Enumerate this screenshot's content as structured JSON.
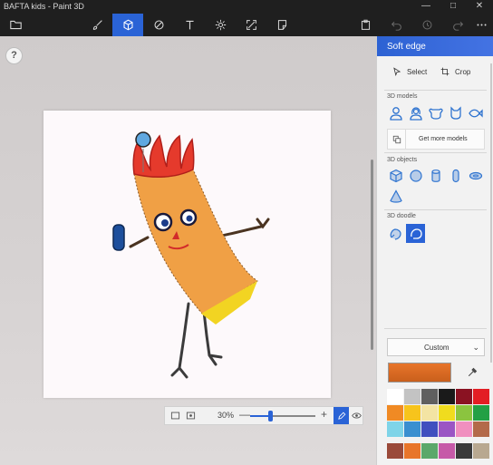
{
  "window": {
    "title": "BAFTA kids - Paint 3D",
    "controls": [
      "minimize",
      "maximize",
      "close"
    ]
  },
  "toolbar": {
    "items": [
      {
        "name": "menu",
        "icon": "folder-icon"
      },
      {
        "name": "brushes",
        "icon": "brush-icon"
      },
      {
        "name": "3d-shapes",
        "icon": "cube-icon",
        "active": true
      },
      {
        "name": "2d-shapes",
        "icon": "shapes-icon"
      },
      {
        "name": "text",
        "icon": "text-icon"
      },
      {
        "name": "effects",
        "icon": "effects-icon"
      },
      {
        "name": "canvas",
        "icon": "canvas-icon"
      },
      {
        "name": "stickers",
        "icon": "sticker-icon"
      },
      {
        "name": "paste",
        "icon": "paste-icon"
      },
      {
        "name": "undo",
        "icon": "undo-icon"
      },
      {
        "name": "history",
        "icon": "history-icon"
      },
      {
        "name": "redo",
        "icon": "redo-icon"
      },
      {
        "name": "more",
        "icon": "more-icon"
      }
    ]
  },
  "workspace": {
    "help": "?"
  },
  "bottombar": {
    "zoom_label": "30%",
    "minus": "—",
    "plus": "+",
    "zoom_fraction": 0.3
  },
  "panel": {
    "header": "Soft edge",
    "select_label": "Select",
    "crop_label": "Crop",
    "models_label": "3D models",
    "get_more_label": "Get more models",
    "objects_label": "3D objects",
    "doodle_label": "3D doodle",
    "color_mode": "Custom",
    "current_color": "#e8752a",
    "palette": [
      "#ffffff",
      "#c3c3c3",
      "#5f5f5f",
      "#1a1a1a",
      "#8a1222",
      "#e31e24",
      "#f08a24",
      "#f7c41c",
      "#f3e4a3",
      "#f0dc1e",
      "#8bc43f",
      "#23a045",
      "#7fd4e8",
      "#3a8fd0",
      "#404fbf",
      "#9b55c4",
      "#f08fbf",
      "#b36a4a"
    ],
    "custom_palette": [
      "#9a4a3a",
      "#e8752a",
      "#5aa86a",
      "#c65aa8",
      "#3a3a3a",
      "#b8a890"
    ]
  }
}
